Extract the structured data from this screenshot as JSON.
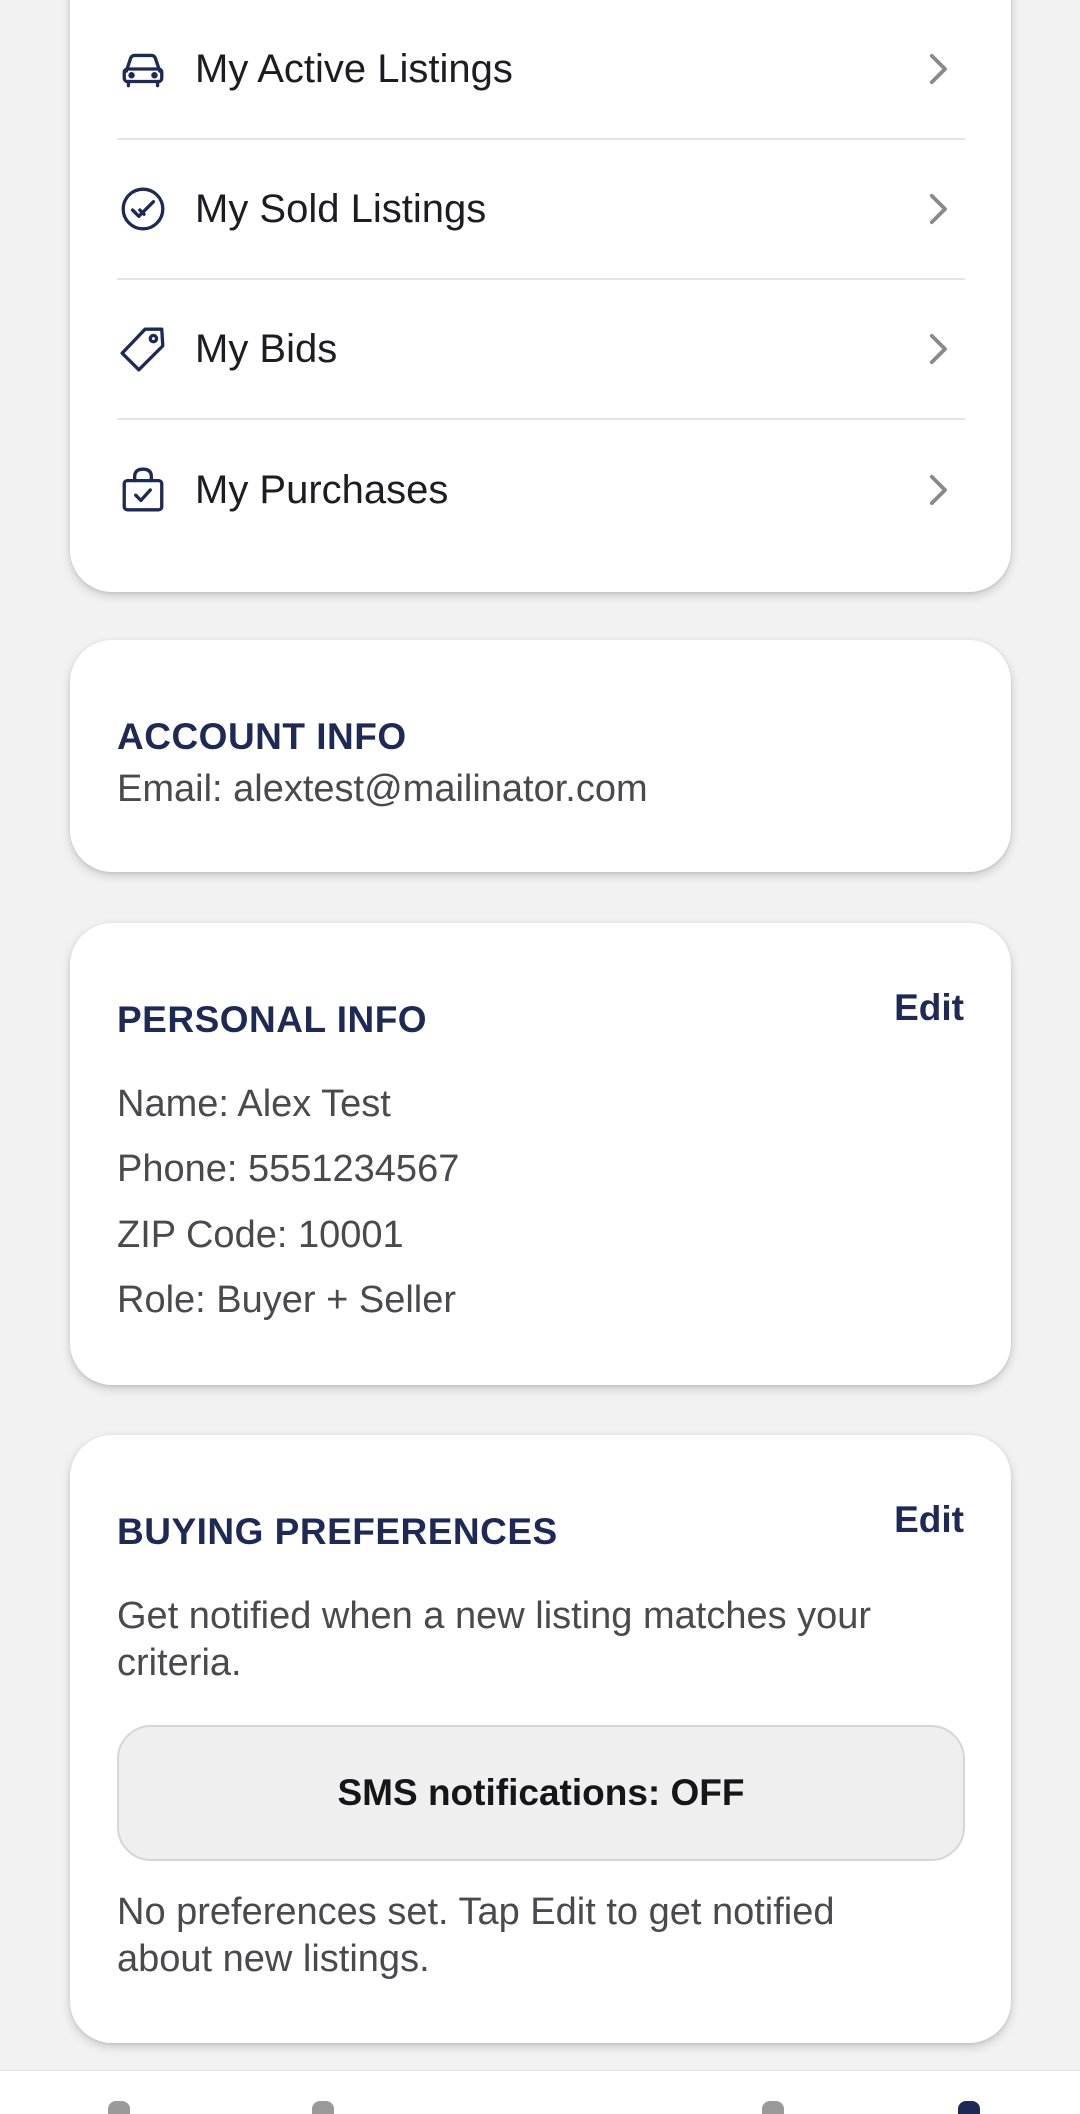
{
  "menu": {
    "items": [
      {
        "label": "My Active Listings",
        "icon": "car-icon"
      },
      {
        "label": "My Sold Listings",
        "icon": "check-circle-icon"
      },
      {
        "label": "My Bids",
        "icon": "tag-icon"
      },
      {
        "label": "My Purchases",
        "icon": "shopping-bag-check-icon"
      }
    ]
  },
  "account": {
    "title": "ACCOUNT INFO",
    "email": "Email: alextest@mailinator.com"
  },
  "personal": {
    "title": "PERSONAL INFO",
    "edit_label": "Edit",
    "name": "Name: Alex Test",
    "phone": "Phone: 5551234567",
    "zip": "ZIP Code: 10001",
    "role": "Role: Buyer + Seller"
  },
  "buying": {
    "title": "BUYING PREFERENCES",
    "edit_label": "Edit",
    "description_line1": "Get notified when a new listing matches your",
    "description_line2": "criteria.",
    "sms_label": "SMS notifications: OFF",
    "empty_line1": "No preferences set. Tap Edit to get notified",
    "empty_line2": "about new listings."
  },
  "colors": {
    "accent": "#1e2a55",
    "background": "#f2f2f2"
  }
}
